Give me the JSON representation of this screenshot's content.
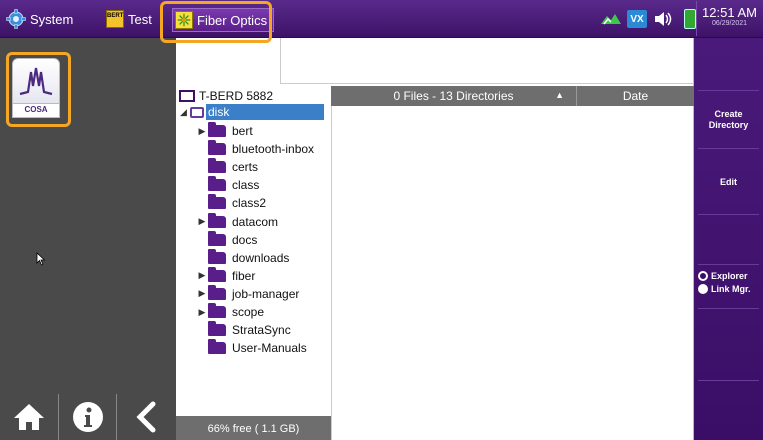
{
  "topbar": {
    "tabs": [
      {
        "label": "System"
      },
      {
        "label": "Test",
        "icon_text": "BERT"
      },
      {
        "label": "Fiber Optics"
      }
    ],
    "status": {
      "vx_label": "VX"
    },
    "clock": {
      "time": "12:51 AM",
      "date": "06/29/2021"
    }
  },
  "left": {
    "app": {
      "label": "COSA"
    }
  },
  "tree": {
    "root": "T-BERD 5882",
    "disk": "disk",
    "folders": [
      {
        "name": "bert",
        "expandable": true
      },
      {
        "name": "bluetooth-inbox",
        "expandable": false
      },
      {
        "name": "certs",
        "expandable": false
      },
      {
        "name": "class",
        "expandable": false
      },
      {
        "name": "class2",
        "expandable": false
      },
      {
        "name": "datacom",
        "expandable": true
      },
      {
        "name": "docs",
        "expandable": false
      },
      {
        "name": "downloads",
        "expandable": false
      },
      {
        "name": "fiber",
        "expandable": true
      },
      {
        "name": "job-manager",
        "expandable": true
      },
      {
        "name": "scope",
        "expandable": true
      },
      {
        "name": "StrataSync",
        "expandable": false
      },
      {
        "name": "User-Manuals",
        "expandable": false
      }
    ],
    "free_space": "66% free ( 1.1 GB)"
  },
  "files": {
    "summary": "0 Files - 13 Directories",
    "date_header": "Date"
  },
  "right": {
    "create_directory": "Create\nDirectory",
    "edit": "Edit",
    "view_options": [
      {
        "label": "Explorer",
        "selected": true
      },
      {
        "label": "Link Mgr.",
        "selected": false
      }
    ]
  },
  "colors": {
    "accent": "#4a1a7a",
    "highlight": "#f5a623",
    "selection": "#3a7fc8"
  }
}
